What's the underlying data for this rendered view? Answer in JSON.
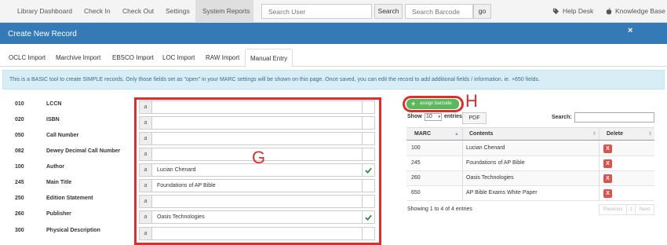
{
  "nav": {
    "library_dashboard": "Library Dashboard",
    "check_in": "Check In",
    "check_out": "Check Out",
    "settings": "Settings",
    "system_reports": "System Reports",
    "search_user_placeholder": "Search User",
    "search_button": "Search",
    "search_barcode_placeholder": "Search Barcode",
    "go_button": "go",
    "help_desk": "Help Desk",
    "knowledge_base": "Knowledge Base"
  },
  "modal": {
    "title": "Create New Record",
    "close": "×"
  },
  "tabs": [
    "OCLC Import",
    "Marchive Import",
    "EBSCO Import",
    "LOC Import",
    "RAW Import",
    "Manual Entry"
  ],
  "active_tab": "Manual Entry",
  "info_text": "This is a BASIC tool to create SIMPLE records. Only those fields set as \"open\" in your MARC settings will be shown on this page. Once saved, you can edit the record to add additional fields / information. ie. +650 fields.",
  "fields": [
    {
      "tag": "010",
      "label": "LCCN",
      "subfield": "a",
      "value": "",
      "valid": false
    },
    {
      "tag": "020",
      "label": "ISBN",
      "subfield": "a",
      "value": "",
      "valid": false
    },
    {
      "tag": "050",
      "label": "Call Number",
      "subfield": "a",
      "value": "",
      "valid": false
    },
    {
      "tag": "082",
      "label": "Dewey Decimal Call Number",
      "subfield": "a",
      "value": "",
      "valid": false
    },
    {
      "tag": "100",
      "label": "Author",
      "subfield": "a",
      "value": "Lucian Chenard",
      "valid": true
    },
    {
      "tag": "245",
      "label": "Main Title",
      "subfield": "a",
      "value": "Foundations of AP Bible",
      "valid": false
    },
    {
      "tag": "250",
      "label": "Edition Statement",
      "subfield": "a",
      "value": "",
      "valid": false
    },
    {
      "tag": "260",
      "label": "Publisher",
      "subfield": "a",
      "value": "Oasis Technologies",
      "valid": true
    },
    {
      "tag": "300",
      "label": "Physical Description",
      "subfield": "a",
      "value": "",
      "valid": false
    }
  ],
  "annotations": {
    "g": "G",
    "h": "H"
  },
  "assign_barcode": "assign barcode",
  "table_controls": {
    "show": "Show",
    "length": "10",
    "entries": "entries",
    "pdf": "PDF",
    "search": "Search:"
  },
  "table": {
    "columns": [
      "MARC",
      "Contents",
      "Delete"
    ],
    "rows": [
      {
        "marc": "100",
        "contents": "Lucian Chenard"
      },
      {
        "marc": "245",
        "contents": "Foundations of AP Bible"
      },
      {
        "marc": "260",
        "contents": "Oasis Technologies"
      },
      {
        "marc": "650",
        "contents": "AP Bible Exams White Paper"
      }
    ],
    "delete_label": "X",
    "info": "Showing 1 to 4 of 4 entries",
    "pager": {
      "previous": "Previous",
      "page": "1",
      "next": "Next"
    }
  },
  "colors": {
    "primary": "#337ab7",
    "annotation": "#d9302e",
    "success": "#5cb85c",
    "danger": "#d9534f",
    "check": "#2e8b3a"
  }
}
